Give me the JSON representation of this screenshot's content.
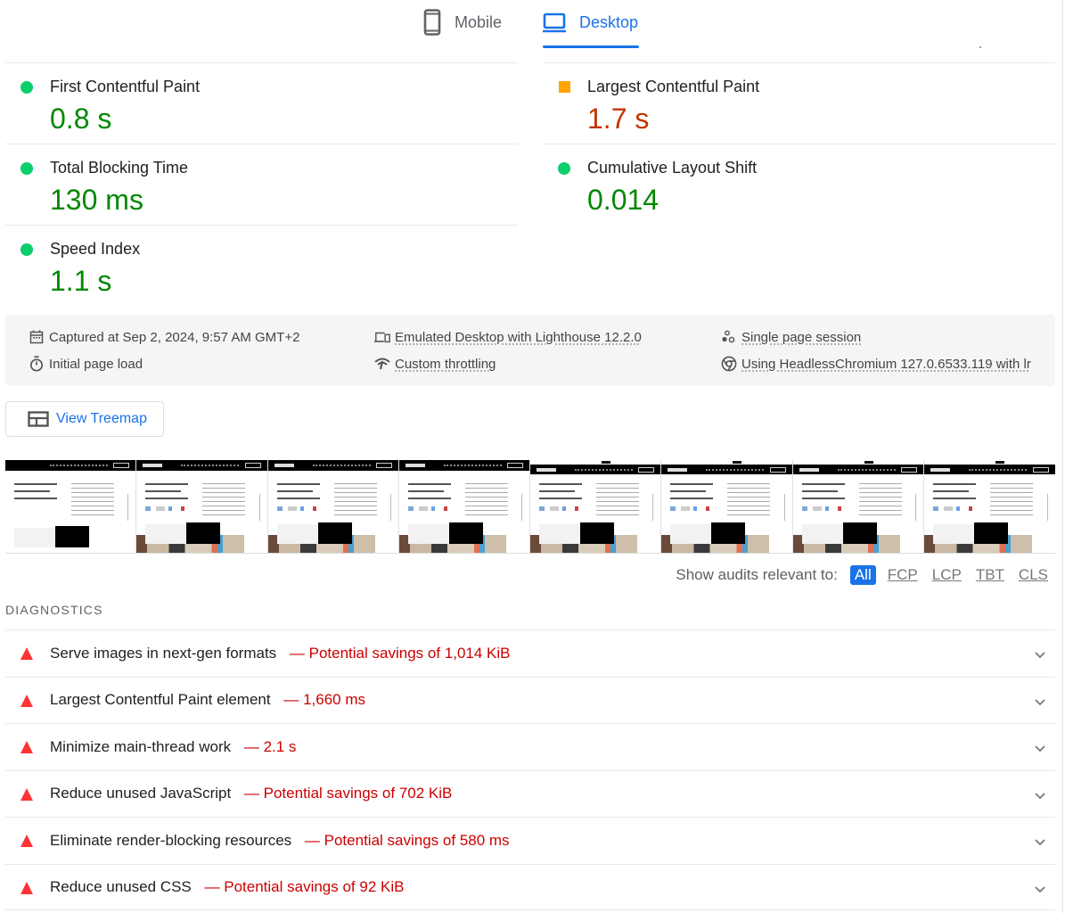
{
  "tabs": [
    {
      "label": "Mobile",
      "icon": "smartphone-icon",
      "active": false
    },
    {
      "label": "Desktop",
      "icon": "laptop-icon",
      "active": true
    }
  ],
  "colors": {
    "accent": "#1a73e8",
    "pass": "#0cce6b",
    "pass_text": "#008800",
    "average": "#ffa400",
    "average_text": "#c33300",
    "fail": "#ff3333",
    "fail_text": "#cc0000"
  },
  "metrics": [
    {
      "label": "First Contentful Paint",
      "value": "0.8 s",
      "status": "pass"
    },
    {
      "label": "Largest Contentful Paint",
      "value": "1.7 s",
      "status": "average"
    },
    {
      "label": "Total Blocking Time",
      "value": "130 ms",
      "status": "pass"
    },
    {
      "label": "Cumulative Layout Shift",
      "value": "0.014",
      "status": "pass"
    },
    {
      "label": "Speed Index",
      "value": "1.1 s",
      "status": "pass"
    }
  ],
  "info": {
    "captured": "Captured at Sep 2, 2024, 9:57 AM GMT+2",
    "load_type": "Initial page load",
    "device": "Emulated Desktop with Lighthouse 12.2.0",
    "throttling": "Custom throttling",
    "session": "Single page session",
    "browser": "Using HeadlessChromium 127.0.6533.119 with lr"
  },
  "treemap": {
    "label": "View Treemap"
  },
  "filmstrip": {
    "frame_count": 8
  },
  "filter": {
    "label": "Show audits relevant to:",
    "options": [
      "All",
      "FCP",
      "LCP",
      "TBT",
      "CLS"
    ],
    "selected": "All"
  },
  "diagnostics": {
    "title": "DIAGNOSTICS",
    "audits": [
      {
        "title": "Serve images in next-gen formats",
        "detail": "Potential savings of 1,014 KiB"
      },
      {
        "title": "Largest Contentful Paint element",
        "detail": "1,660 ms"
      },
      {
        "title": "Minimize main-thread work",
        "detail": "2.1 s"
      },
      {
        "title": "Reduce unused JavaScript",
        "detail": "Potential savings of 702 KiB"
      },
      {
        "title": "Eliminate render-blocking resources",
        "detail": "Potential savings of 580 ms"
      },
      {
        "title": "Reduce unused CSS",
        "detail": "Potential savings of 92 KiB"
      }
    ]
  }
}
